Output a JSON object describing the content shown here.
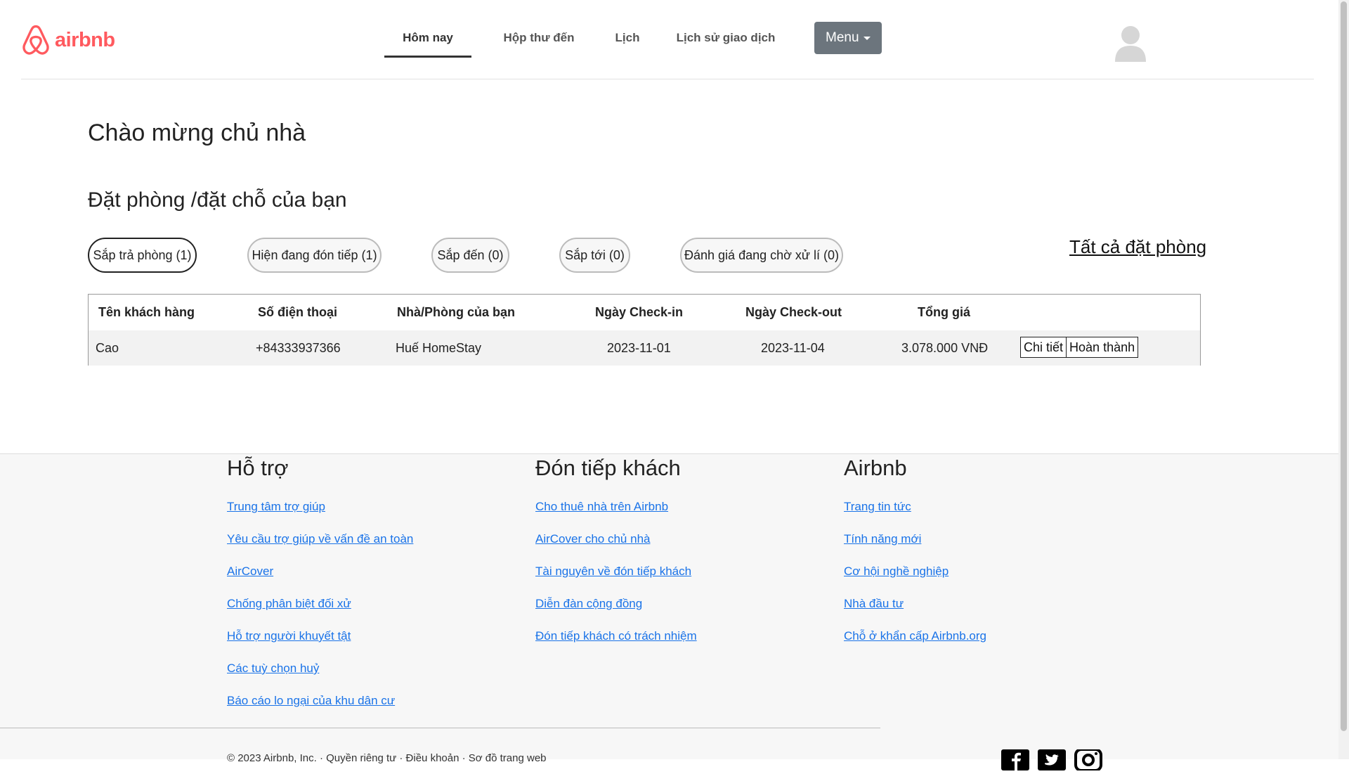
{
  "brand": {
    "name": "airbnb",
    "color": "#FF5A5F"
  },
  "nav": {
    "items": [
      {
        "label": "Hôm nay",
        "active": true
      },
      {
        "label": "Hộp thư đến"
      },
      {
        "label": "Lịch"
      },
      {
        "label": "Lịch sử giao dịch"
      }
    ],
    "menu_label": "Menu"
  },
  "main": {
    "title": "Chào mừng chủ nhà",
    "section_title": "Đặt phòng /đặt chỗ của bạn",
    "filters": [
      {
        "label": "Sắp trả phòng (1)",
        "active": true
      },
      {
        "label": "Hiện đang đón tiếp (1)"
      },
      {
        "label": "Sắp đến (0)"
      },
      {
        "label": "Sắp tới (0)"
      },
      {
        "label": "Đánh giá đang chờ xử lí (0)"
      }
    ],
    "all_bookings_label": "Tất cả đặt phòng",
    "table": {
      "headers": [
        "Tên khách hàng",
        "Số điện thoại",
        "Nhà/Phòng của bạn",
        "Ngày Check-in",
        "Ngày Check-out",
        "Tổng giá"
      ],
      "rows": [
        [
          "Cao",
          "+84333937366",
          "Huế HomeStay",
          "2023-11-01",
          "2023-11-04",
          "3.078.000 VNĐ"
        ]
      ],
      "actions": {
        "detail": "Chi tiết",
        "complete": "Hoàn thành"
      }
    }
  },
  "footer": {
    "columns": [
      {
        "title": "Hỗ trợ",
        "links": [
          "Trung tâm trợ giúp",
          "Yêu cầu trợ giúp về vấn đề an toàn",
          "AirCover",
          "Chống phân biệt đối xử",
          "Hỗ trợ người khuyết tật",
          "Các tuỳ chọn huỷ",
          "Báo cáo lo ngại của khu dân cư"
        ]
      },
      {
        "title": "Đón tiếp khách",
        "links": [
          "Cho thuê nhà trên Airbnb",
          "AirCover cho chủ nhà",
          "Tài nguyên về đón tiếp khách",
          "Diễn đàn cộng đồng",
          "Đón tiếp khách có trách nhiệm"
        ]
      },
      {
        "title": "Airbnb",
        "links": [
          "Trang tin tức",
          "Tính năng mới",
          "Cơ hội nghề nghiệp",
          "Nhà đầu tư",
          "Chỗ ở khẩn cấp Airbnb.org"
        ]
      }
    ],
    "copyright": "© 2023 Airbnb, Inc. · Quyền riêng tư · Điều khoản · Sơ đồ trang web",
    "social_icons": [
      "facebook-icon",
      "twitter-icon",
      "instagram-icon"
    ]
  }
}
